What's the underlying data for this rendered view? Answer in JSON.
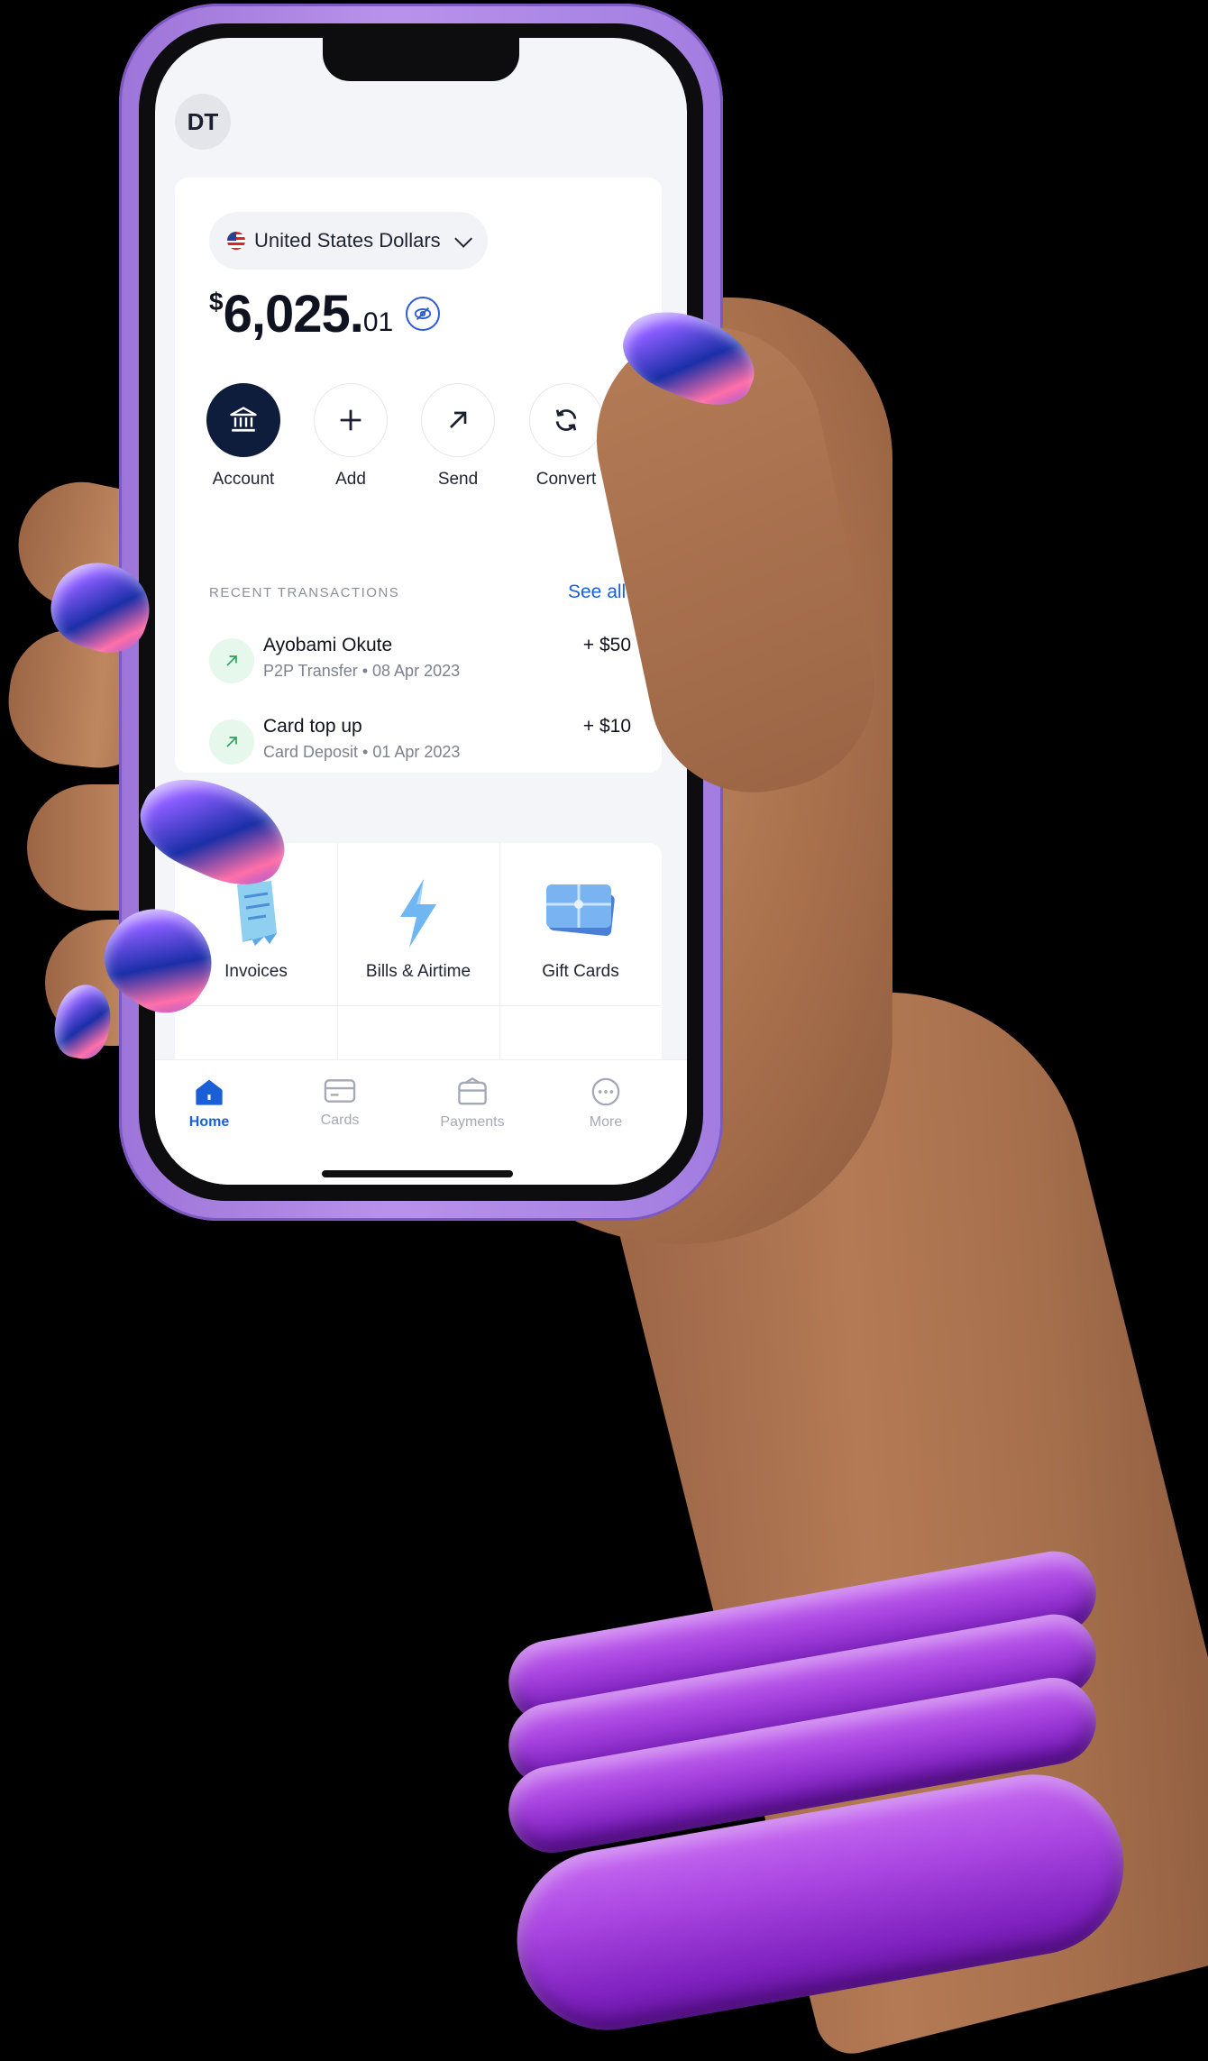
{
  "profile": {
    "initials": "DT"
  },
  "wallet": {
    "currency_name": "United States Dollars",
    "currency_symbol": "$",
    "balance_main": "6,025.",
    "balance_decimal": "01"
  },
  "actions": [
    {
      "label": "Account",
      "icon": "bank-icon"
    },
    {
      "label": "Add",
      "icon": "plus-icon"
    },
    {
      "label": "Send",
      "icon": "arrow-up-right-icon"
    },
    {
      "label": "Convert",
      "icon": "refresh-icon"
    }
  ],
  "recent": {
    "title": "RECENT TRANSACTIONS",
    "see_all": "See all",
    "items": [
      {
        "name": "Ayobami Okute",
        "detail": "P2P Transfer • 08 Apr 2023",
        "amount": "+ $50"
      },
      {
        "name": "Card top up",
        "detail": "Card Deposit • 01 Apr 2023",
        "amount": "+ $10"
      }
    ]
  },
  "services": [
    {
      "label": "Invoices",
      "icon": "receipt-icon"
    },
    {
      "label": "Bills & Airtime",
      "icon": "lightning-icon"
    },
    {
      "label": "Gift Cards",
      "icon": "gift-card-icon"
    }
  ],
  "tabs": [
    {
      "label": "Home",
      "icon": "home-icon",
      "active": true
    },
    {
      "label": "Cards",
      "icon": "card-icon",
      "active": false
    },
    {
      "label": "Payments",
      "icon": "wallet-icon",
      "active": false
    },
    {
      "label": "More",
      "icon": "more-icon",
      "active": false
    }
  ],
  "colors": {
    "accent": "#1b5fd6",
    "dark_button": "#0e1d3b",
    "phone_case": "#b892ea",
    "bangle": "#a844e0"
  }
}
